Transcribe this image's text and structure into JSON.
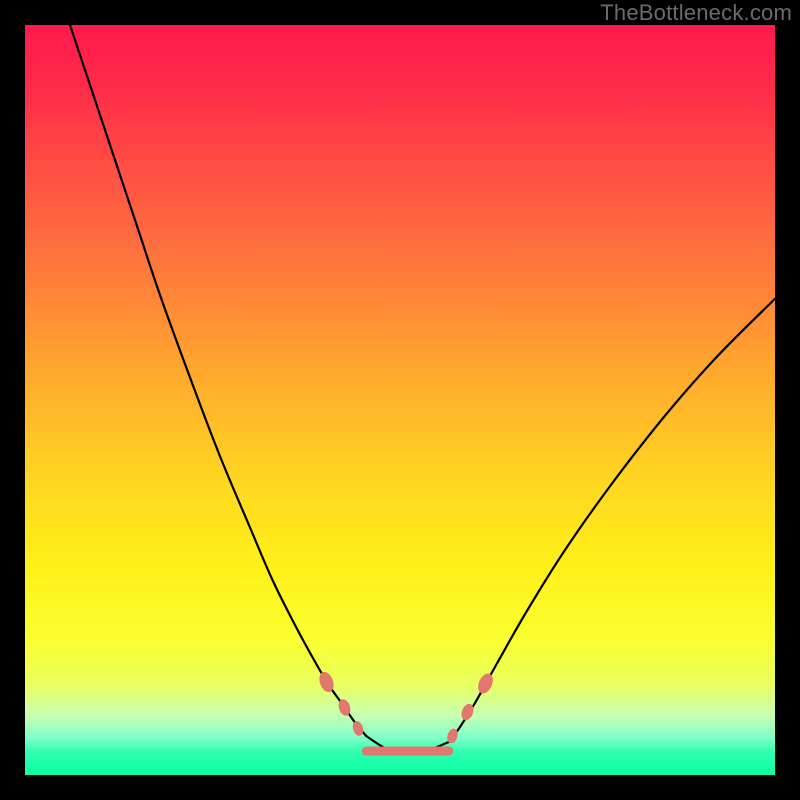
{
  "watermark": "TheBottleneck.com",
  "chart_data": {
    "type": "line",
    "title": "",
    "xlabel": "",
    "ylabel": "",
    "xlim": [
      0,
      100
    ],
    "ylim": [
      0,
      100
    ],
    "series": [
      {
        "name": "left-branch",
        "x": [
          6,
          9,
          12,
          15,
          18,
          22,
          26,
          30,
          33,
          36,
          38.5,
          40.5,
          42.2,
          44,
          45.5
        ],
        "values": [
          100,
          91,
          82,
          73,
          64,
          53,
          42.5,
          33,
          26,
          20,
          15.4,
          12,
          9.6,
          7,
          5.2
        ]
      },
      {
        "name": "flat-bottom",
        "x": [
          45.5,
          48,
          50,
          52,
          54,
          56.5
        ],
        "values": [
          5.2,
          3.6,
          3.2,
          3.2,
          3.4,
          4.4
        ]
      },
      {
        "name": "right-branch",
        "x": [
          56.5,
          58,
          60,
          63,
          67,
          72,
          78,
          85,
          92,
          100
        ],
        "values": [
          4.4,
          6.4,
          9.6,
          15,
          22,
          30,
          38.5,
          47.5,
          55.5,
          63.5
        ]
      }
    ],
    "markers": [
      {
        "name": "left-upper",
        "x": 40.2,
        "y": 12.4,
        "rx": 6,
        "ry": 10,
        "rot": -20
      },
      {
        "name": "left-mid",
        "x": 42.6,
        "y": 9.0,
        "rx": 5,
        "ry": 8,
        "rot": -18
      },
      {
        "name": "left-low",
        "x": 44.4,
        "y": 6.2,
        "rx": 4.5,
        "ry": 7,
        "rot": -18
      },
      {
        "name": "right-low",
        "x": 57.0,
        "y": 5.2,
        "rx": 4.5,
        "ry": 7,
        "rot": 18
      },
      {
        "name": "right-mid",
        "x": 59.0,
        "y": 8.4,
        "rx": 5,
        "ry": 8,
        "rot": 20
      },
      {
        "name": "right-upper",
        "x": 61.4,
        "y": 12.2,
        "rx": 6,
        "ry": 10,
        "rot": 24
      }
    ],
    "flat_marker": {
      "x1": 45.5,
      "x2": 56.5,
      "y": 3.2
    },
    "background": {
      "type": "vertical-gradient",
      "top_color": "#ff1a4d",
      "bottom_color": "#0dffa0"
    }
  }
}
